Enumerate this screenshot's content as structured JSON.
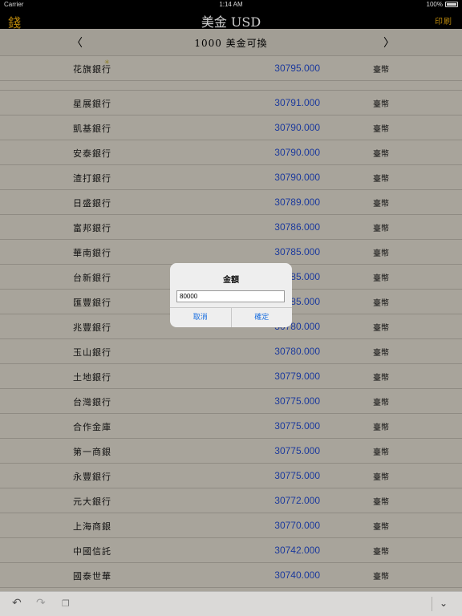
{
  "status_bar": {
    "carrier": "Carrier",
    "time": "1:14 AM",
    "battery": "100%"
  },
  "nav": {
    "left_icon_glyph": "錢",
    "title": "美金 USD",
    "right_label": "印刷"
  },
  "subheader": {
    "prev": "〈",
    "title": "1000  美金可換",
    "next": "〉"
  },
  "rows": [
    {
      "bank": "花旗銀行",
      "rate": "30795.000",
      "currency": "臺幣"
    },
    {
      "bank": "星展銀行",
      "rate": "30791.000",
      "currency": "臺幣"
    },
    {
      "bank": "凱基銀行",
      "rate": "30790.000",
      "currency": "臺幣"
    },
    {
      "bank": "安泰銀行",
      "rate": "30790.000",
      "currency": "臺幣"
    },
    {
      "bank": "渣打銀行",
      "rate": "30790.000",
      "currency": "臺幣"
    },
    {
      "bank": "日盛銀行",
      "rate": "30789.000",
      "currency": "臺幣"
    },
    {
      "bank": "富邦銀行",
      "rate": "30786.000",
      "currency": "臺幣"
    },
    {
      "bank": "華南銀行",
      "rate": "30785.000",
      "currency": "臺幣"
    },
    {
      "bank": "台新銀行",
      "rate": "30785.000",
      "currency": "臺幣"
    },
    {
      "bank": "匯豐銀行",
      "rate": "30785.000",
      "currency": "臺幣"
    },
    {
      "bank": "兆豐銀行",
      "rate": "30780.000",
      "currency": "臺幣"
    },
    {
      "bank": "玉山銀行",
      "rate": "30780.000",
      "currency": "臺幣"
    },
    {
      "bank": "土地銀行",
      "rate": "30779.000",
      "currency": "臺幣"
    },
    {
      "bank": "台灣銀行",
      "rate": "30775.000",
      "currency": "臺幣"
    },
    {
      "bank": "合作金庫",
      "rate": "30775.000",
      "currency": "臺幣"
    },
    {
      "bank": "第一商銀",
      "rate": "30775.000",
      "currency": "臺幣"
    },
    {
      "bank": "永豐銀行",
      "rate": "30775.000",
      "currency": "臺幣"
    },
    {
      "bank": "元大銀行",
      "rate": "30772.000",
      "currency": "臺幣"
    },
    {
      "bank": "上海商銀",
      "rate": "30770.000",
      "currency": "臺幣"
    },
    {
      "bank": "中國信託",
      "rate": "30742.000",
      "currency": "臺幣"
    },
    {
      "bank": "國泰世華",
      "rate": "30740.000",
      "currency": "臺幣"
    }
  ],
  "dialog": {
    "title": "金額",
    "input_value": "80000",
    "cancel_label": "取消",
    "confirm_label": "確定"
  },
  "toolbar": {
    "undo_icon": "undo-icon",
    "redo_icon": "redo-icon",
    "paste_icon": "paste-icon",
    "dismiss_icon": "chevron-down-icon"
  }
}
